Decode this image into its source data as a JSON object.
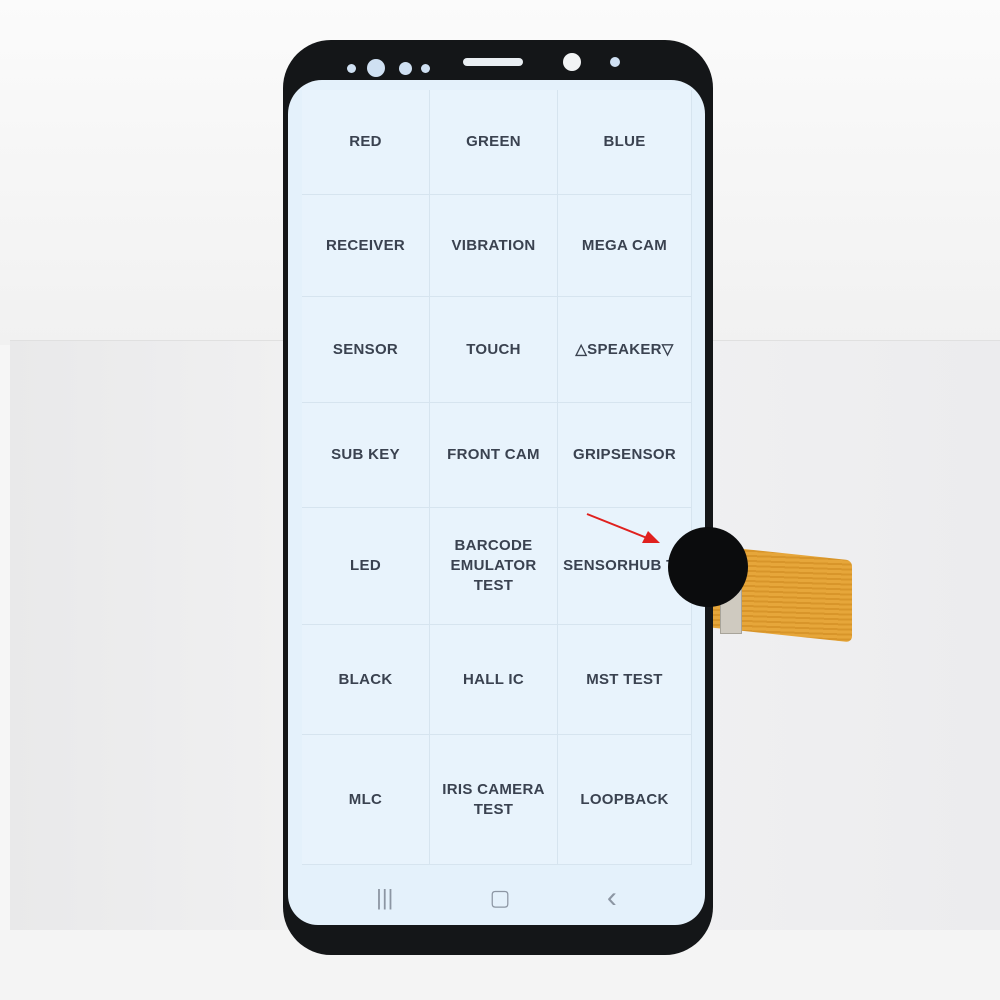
{
  "tests": [
    [
      "RED",
      "GREEN",
      "BLUE"
    ],
    [
      "RECEIVER",
      "VIBRATION",
      "MEGA CAM"
    ],
    [
      "SENSOR",
      "TOUCH",
      "△SPEAKER▽"
    ],
    [
      "SUB KEY",
      "FRONT CAM",
      "GRIPSENSOR"
    ],
    [
      "LED",
      "BARCODE EMULATOR TEST",
      "SENSORHUB TE"
    ],
    [
      "BLACK",
      "HALL IC",
      "MST TEST"
    ],
    [
      "MLC",
      "IRIS CAMERA TEST",
      "LOOPBACK"
    ]
  ],
  "nav": {
    "recent": "|||",
    "home": "▢",
    "back": "‹"
  },
  "colors": {
    "screen": "#e4f1fb",
    "text": "#3a4250",
    "arrow": "#e0201e",
    "cable": "#e6a63a"
  }
}
